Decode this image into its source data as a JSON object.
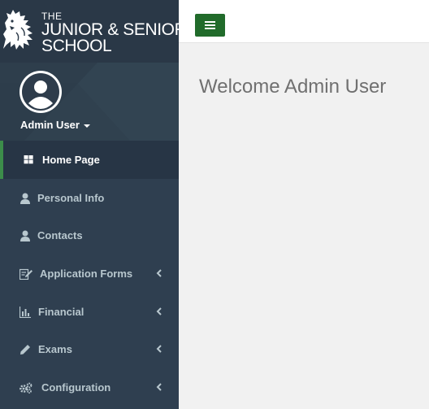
{
  "brand": {
    "line1": "THE",
    "line2": "JUNIOR & SENIOR",
    "line3": "SCHOOL",
    "logo_icon": "lion-rampant-icon"
  },
  "user": {
    "name": "Admin User",
    "avatar_icon": "user-avatar-icon",
    "dropdown_icon": "caret-down-icon"
  },
  "sidebar": {
    "items": [
      {
        "label": "Home Page",
        "icon": "grid-icon",
        "active": true,
        "has_submenu": false
      },
      {
        "label": "Personal Info",
        "icon": "user-icon",
        "active": false,
        "has_submenu": false
      },
      {
        "label": "Contacts",
        "icon": "user-icon",
        "active": false,
        "has_submenu": false
      },
      {
        "label": "Application Forms",
        "icon": "edit-form-icon",
        "active": false,
        "has_submenu": true
      },
      {
        "label": "Financial",
        "icon": "bar-chart-icon",
        "active": false,
        "has_submenu": true
      },
      {
        "label": "Exams",
        "icon": "pencil-icon",
        "active": false,
        "has_submenu": true
      },
      {
        "label": "Configuration",
        "icon": "cogs-icon",
        "active": false,
        "has_submenu": true
      }
    ]
  },
  "header": {
    "toggle_icon": "hamburger-icon"
  },
  "main": {
    "welcome": "Welcome Admin User"
  },
  "colors": {
    "sidebar_bg": "#2f3f50",
    "sidebar_active_bg": "#273545",
    "active_indicator": "#3c8d4a",
    "toggle_button": "#216b2b",
    "sidebar_text": "#b8c7ce",
    "content_bg": "#f1f1f1"
  }
}
